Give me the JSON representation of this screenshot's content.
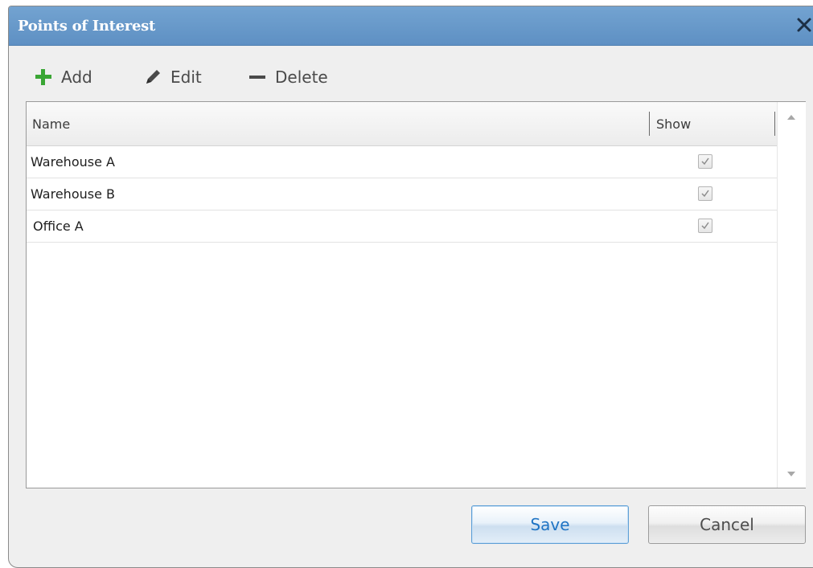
{
  "window": {
    "title": "Points of Interest"
  },
  "toolbar": {
    "add_label": "Add",
    "edit_label": "Edit",
    "delete_label": "Delete",
    "add_icon": "plus-icon",
    "edit_icon": "pencil-icon",
    "delete_icon": "minus-icon",
    "add_icon_color": "#3aa634",
    "edit_icon_color": "#4a4a4a",
    "delete_icon_color": "#4a4a4a"
  },
  "grid": {
    "columns": [
      "Name",
      "Show"
    ],
    "rows": [
      {
        "name": "Warehouse A",
        "show": true
      },
      {
        "name": "Warehouse B",
        "show": true
      },
      {
        "name": "Office A",
        "show": true
      }
    ]
  },
  "buttons": {
    "save_label": "Save",
    "cancel_label": "Cancel"
  },
  "colors": {
    "titlebar": "#6a9acb",
    "accent": "#1f74c4"
  }
}
